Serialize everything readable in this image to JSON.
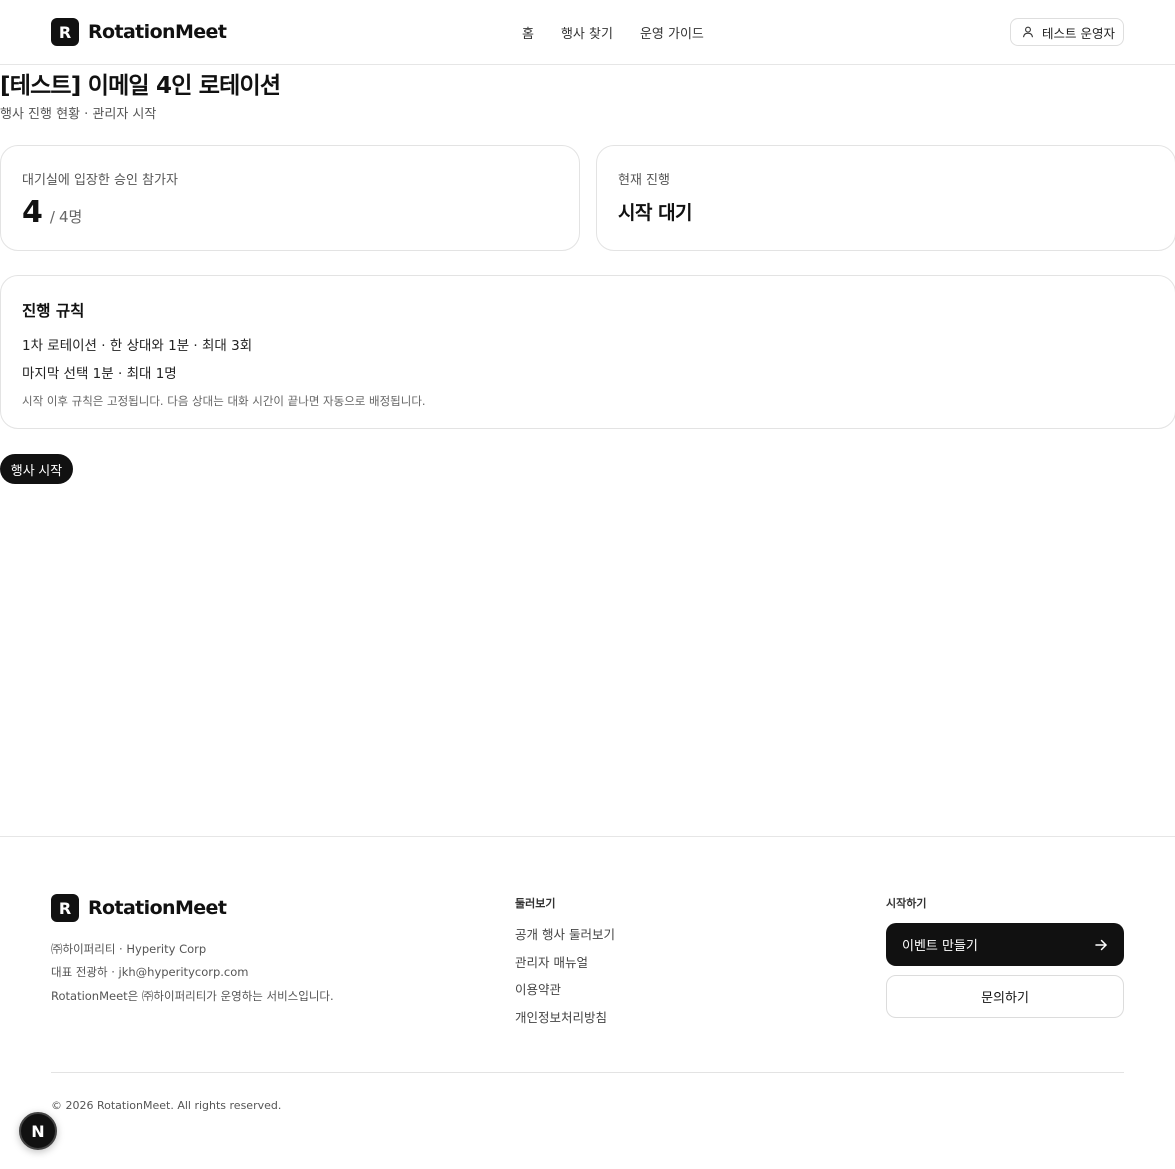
{
  "header": {
    "logo_letter": "R",
    "brand": "RotationMeet",
    "nav": [
      "홈",
      "행사 찾기",
      "운영 가이드"
    ],
    "user_label": "테스트 운영자"
  },
  "main": {
    "title": "[테스트] 이메일 4인 로테이션",
    "subtitle": "행사 진행 현황 · 관리자 시작",
    "participants_card": {
      "label": "대기실에 입장한 승인 참가자",
      "count": "4",
      "separator": "/",
      "total": "4명"
    },
    "status_card": {
      "label": "현재 진행",
      "value": "시작 대기"
    },
    "rules": {
      "title": "진행 규칙",
      "line1": "1차 로테이션 · 한 상대와 1분 · 최대 3회",
      "line2": "마지막 선택 1분 · 최대 1명",
      "note": "시작 이후 규칙은 고정됩니다. 다음 상대는 대화 시간이 끝나면 자동으로 배정됩니다."
    },
    "start_button": "행사 시작"
  },
  "footer": {
    "logo_letter": "R",
    "brand": "RotationMeet",
    "info": [
      "㈜하이퍼리티 · Hyperity Corp",
      "대표 전광하 · jkh@hyperitycorp.com",
      "RotationMeet은 ㈜하이퍼리티가 운영하는 서비스입니다."
    ],
    "browse_heading": "둘러보기",
    "browse_links": [
      "공개 행사 둘러보기",
      "관리자 매뉴얼",
      "이용약관",
      "개인정보처리방침"
    ],
    "start_heading": "시작하기",
    "create_event": "이벤트 만들기",
    "contact": "문의하기",
    "copyright": "© 2026 RotationMeet. All rights reserved."
  },
  "dev_badge": "N",
  "icons": {
    "user": "user-icon",
    "arrow": "arrow-right-icon"
  },
  "colors": {
    "primary": "#111111",
    "border": "#e3e3e3",
    "muted_text": "#555555"
  }
}
